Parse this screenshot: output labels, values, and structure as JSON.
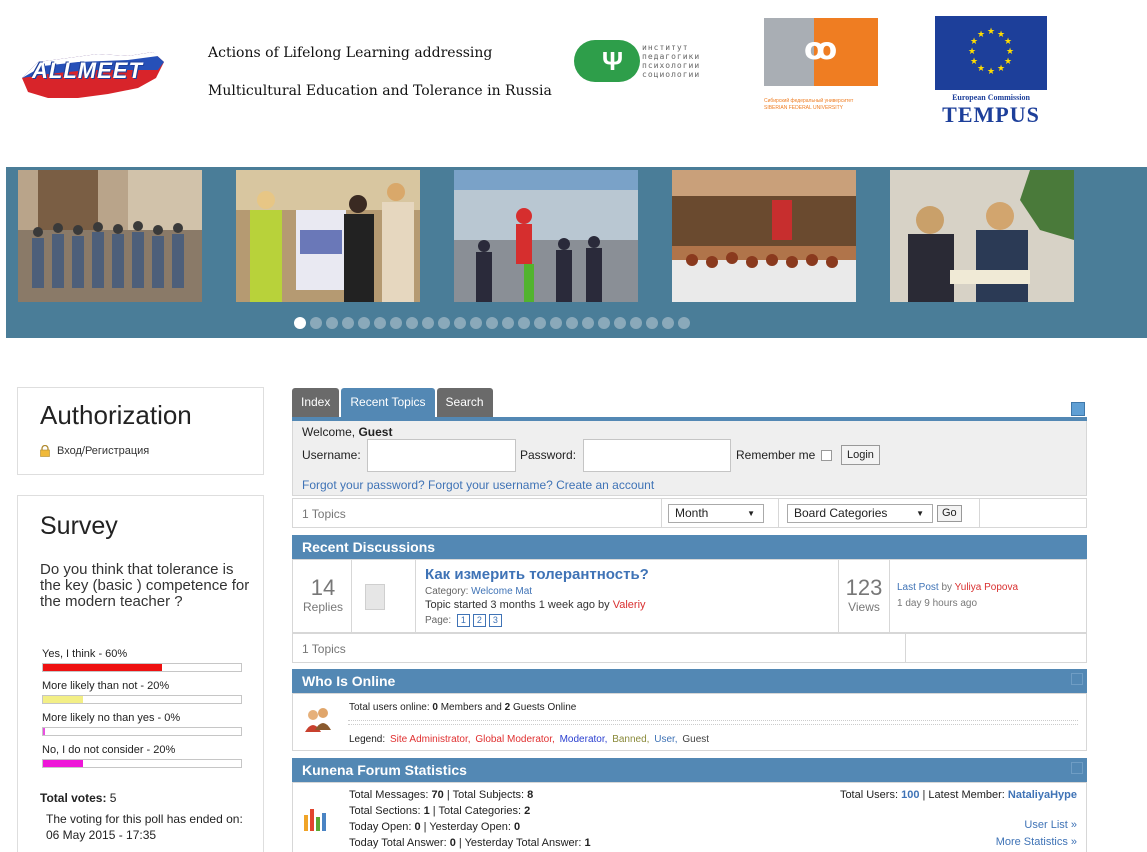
{
  "header": {
    "logo_text": "ALLMEET",
    "title_line1": "Actions of Lifelong Learning addressing",
    "title_line2": "Multicultural Education and Tolerance in Russia",
    "institute_logo_text": [
      "институт",
      "педагогики",
      "психологии",
      "социологии"
    ],
    "sfu_caption": [
      "Сибирский федеральный университет",
      "SIBERIAN FEDERAL UNIVERSITY"
    ],
    "eu_caption": "European Commission",
    "tempus_label": "TEMPUS"
  },
  "slider": {
    "dot_count": 25,
    "active_dot": 0
  },
  "authorization": {
    "title": "Authorization",
    "login_link": "Вход/Регистрация"
  },
  "survey": {
    "title": "Survey",
    "question": "Do you think that tolerance is the key (basic ) competence for the modern teacher ?",
    "options": [
      {
        "label": "Yes, I think - 60%",
        "percent": 60,
        "color": "#ee1111"
      },
      {
        "label": "More likely than not - 20%",
        "percent": 20,
        "color": "#f3ef86"
      },
      {
        "label": "More likely no than yes - 0%",
        "percent": 0,
        "color": "#e84fe0"
      },
      {
        "label": "No, I do not consider - 20%",
        "percent": 20,
        "color": "#ee16d8"
      }
    ],
    "total_label": "Total votes:",
    "total_value": "5",
    "ended_text": "The voting for this poll has ended on: 06 May 2015 - 17:35"
  },
  "forum": {
    "tabs": [
      "Index",
      "Recent Topics",
      "Search"
    ],
    "active_tab": 1,
    "welcome_prefix": "Welcome, ",
    "welcome_user": "Guest",
    "username_label": "Username:",
    "password_label": "Password:",
    "remember_label": "Remember me",
    "login_button": "Login",
    "forgot_text": "Forgot your password? Forgot your username? Create an account",
    "topics_count_label": "1 Topics",
    "period_select": "Month",
    "category_select": "Board Categories",
    "go_button": "Go",
    "recent_header": "Recent Discussions",
    "topic": {
      "replies_num": "14",
      "replies_label": "Replies",
      "title": "Как измерить толерантность?",
      "category_label": "Category: ",
      "category_value": "Welcome Mat",
      "started_text": "Topic started 3 months 1 week ago by ",
      "started_by": "Valeriy",
      "page_label": "Page:",
      "pages": [
        "1",
        "2",
        "3"
      ],
      "views_num": "123",
      "views_label": "Views",
      "last_post_label": "Last Post",
      "last_post_by": " by ",
      "last_post_user": "Yuliya Popova",
      "last_post_time": "1 day 9 hours ago"
    },
    "topics_count_bottom": "1 Topics",
    "online_header": "Who Is Online",
    "online_text_1": "Total users online: ",
    "online_members": "0",
    "online_text_2": " Members and ",
    "online_guests": "2",
    "online_text_3": " Guests Online",
    "legend_label": "Legend: ",
    "legend": [
      {
        "label": "Site Administrator,",
        "color": "#e03030"
      },
      {
        "label": "Global Moderator,",
        "color": "#e03030"
      },
      {
        "label": "Moderator,",
        "color": "#2a3fd0"
      },
      {
        "label": "Banned,",
        "color": "#8a8a3a"
      },
      {
        "label": "User,",
        "color": "#3f73b6"
      },
      {
        "label": "Guest",
        "color": "#444444"
      }
    ],
    "stats_header": "Kunena Forum Statistics",
    "stats": {
      "total_messages_label": "Total Messages: ",
      "total_messages": "70",
      "total_subjects_label": "Total Subjects: ",
      "total_subjects": "8",
      "total_sections_label": "Total Sections: ",
      "total_sections": "1",
      "total_categories_label": "Total Categories: ",
      "total_categories": "2",
      "today_open_label": "Today Open: ",
      "today_open": "0",
      "yesterday_open_label": "Yesterday Open: ",
      "yesterday_open": "0",
      "today_answer_label": "Today Total Answer: ",
      "today_answer": "0",
      "yesterday_answer_label": "Yesterday Total Answer: ",
      "yesterday_answer": "1",
      "total_users_label": "Total Users: ",
      "total_users": "100",
      "latest_member_label": "Latest Member: ",
      "latest_member": "NataliyaHype",
      "user_list_link": "User List »",
      "more_stats_link": "More Statistics »"
    }
  }
}
